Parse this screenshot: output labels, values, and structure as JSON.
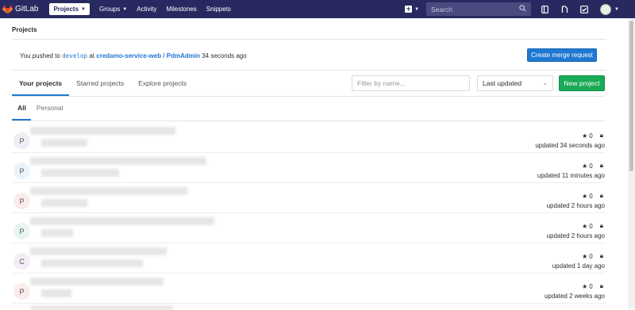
{
  "topbar": {
    "logo_text": "GitLab",
    "nav": [
      {
        "label": "Projects",
        "active": true,
        "dropdown": true
      },
      {
        "label": "Groups",
        "active": false,
        "dropdown": true
      },
      {
        "label": "Activity",
        "active": false,
        "dropdown": false
      },
      {
        "label": "Milestones",
        "active": false,
        "dropdown": false
      },
      {
        "label": "Snippets",
        "active": false,
        "dropdown": false
      }
    ],
    "search_placeholder": "Search",
    "colors": {
      "bar": "#292961",
      "search_bg": "#4a4a7f"
    }
  },
  "breadcrumb": "Projects",
  "push_notice": {
    "prefix": "You pushed to",
    "branch": "develop",
    "at": "at",
    "project": "credamo-service-web / PdmAdmin",
    "time": "34 seconds ago",
    "button": "Create merge request"
  },
  "tabs": [
    "Your projects",
    "Starred projects",
    "Explore projects"
  ],
  "filter_placeholder": "Filter by name...",
  "sort_value": "Last updated",
  "new_project_label": "New project",
  "subtabs": [
    "All",
    "Personal"
  ],
  "projects": [
    {
      "initial": "P",
      "stars": "0",
      "updated": "updated 34 seconds ago",
      "avatar_color": "#eeeef6"
    },
    {
      "initial": "P",
      "stars": "0",
      "updated": "updated 11 minutes ago",
      "avatar_color": "#e9f3fb"
    },
    {
      "initial": "P",
      "stars": "0",
      "updated": "updated 2 hours ago",
      "avatar_color": "#fbeceb"
    },
    {
      "initial": "P",
      "stars": "0",
      "updated": "updated 2 hours ago",
      "avatar_color": "#e9f5ef"
    },
    {
      "initial": "C",
      "stars": "0",
      "updated": "updated 1 day ago",
      "avatar_color": "#f4ecf6"
    },
    {
      "initial": "P",
      "stars": "0",
      "updated": "updated 2 weeks ago",
      "avatar_color": "#fbeceb"
    }
  ],
  "colors": {
    "link": "#1f78d1",
    "primary": "#1f78d1",
    "success": "#1aaa55"
  }
}
